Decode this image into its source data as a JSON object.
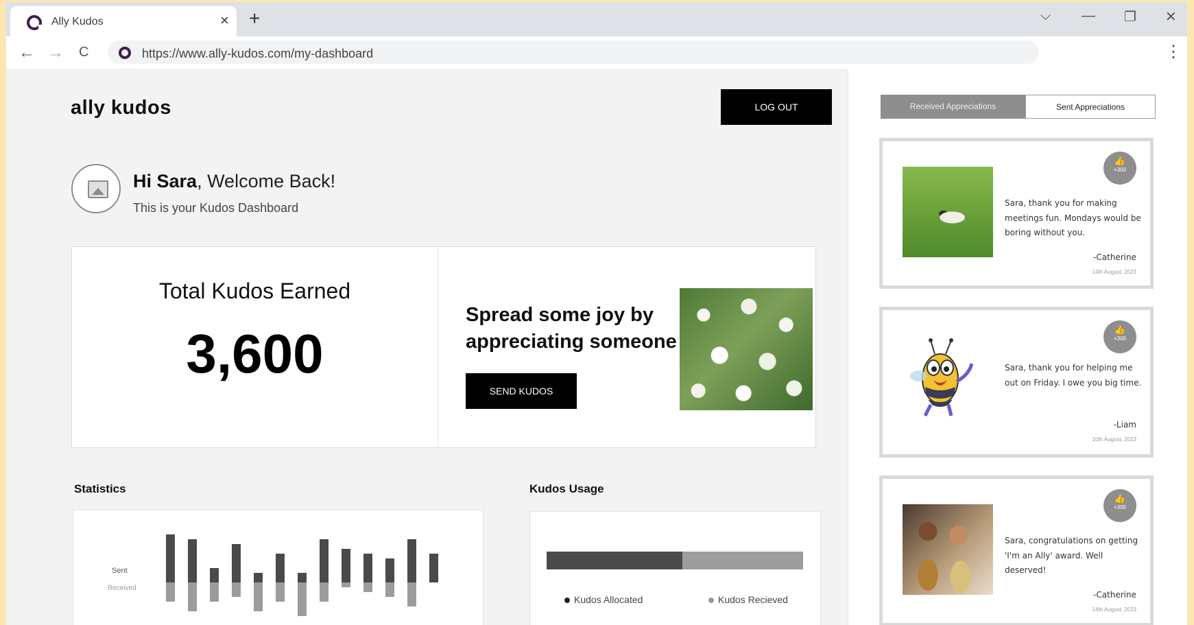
{
  "browser": {
    "tab_title": "Ally Kudos",
    "tab_close": "×",
    "new_tab": "+",
    "url": "https://www.ally-kudos.com/my-dashboard",
    "controls": {
      "chevron": "⌵",
      "minimize": "—",
      "restore": "❐",
      "close": "✕",
      "menu": "⋮"
    },
    "nav": {
      "back": "←",
      "forward": "→",
      "reload": "C"
    }
  },
  "header": {
    "logo": "ally kudos",
    "logout_label": "LOG OUT"
  },
  "greeting": {
    "name": "Hi Sara",
    "welcome": ", Welcome Back!",
    "subtitle": "This is your Kudos Dashboard"
  },
  "total": {
    "title": "Total Kudos Earned",
    "value": "3,600"
  },
  "spread": {
    "text": "Spread some joy by appreciating someone",
    "button_label": "SEND KUDOS"
  },
  "statistics": {
    "title": "Statistics",
    "legend_sent": "Sent",
    "legend_received": "Received"
  },
  "chart_data": {
    "type": "bar",
    "series": [
      {
        "name": "Sent",
        "values": [
          10,
          9,
          3,
          8,
          2,
          6,
          2,
          9,
          7,
          6,
          5,
          9,
          6
        ]
      },
      {
        "name": "Received",
        "values": [
          4,
          6,
          4,
          3,
          6,
          4,
          7,
          4,
          1,
          2,
          3,
          5,
          0
        ]
      }
    ]
  },
  "usage": {
    "title": "Kudos Usage",
    "allocated_label": "Kudos Allocated",
    "received_label": "Kudos Recieved",
    "allocated_fraction": 0.53,
    "allocated_color": "#4a4a4a",
    "received_color": "#9c9c9c"
  },
  "sidebar": {
    "tab_received": "Received Appreciations",
    "tab_sent": "Sent Appreciations",
    "cards": [
      {
        "image": "kitten-photo",
        "points": "+300",
        "message": "Sara, thank you for making meetings fun. Mondays would be boring without you.",
        "from": "-Catherine",
        "date": "14th August, 2023"
      },
      {
        "image": "bee-cartoon",
        "points": "+300",
        "message": "Sara, thank you for helping me out on Friday. I owe you big time.",
        "from": "-Liam",
        "date": "10th August, 2023"
      },
      {
        "image": "people-clapping-photo",
        "points": "+300",
        "message": "Sara, congratulations on getting 'I'm an Ally' award. Well deserved!",
        "from": "-Catherine",
        "date": "14th August, 2023"
      }
    ]
  }
}
